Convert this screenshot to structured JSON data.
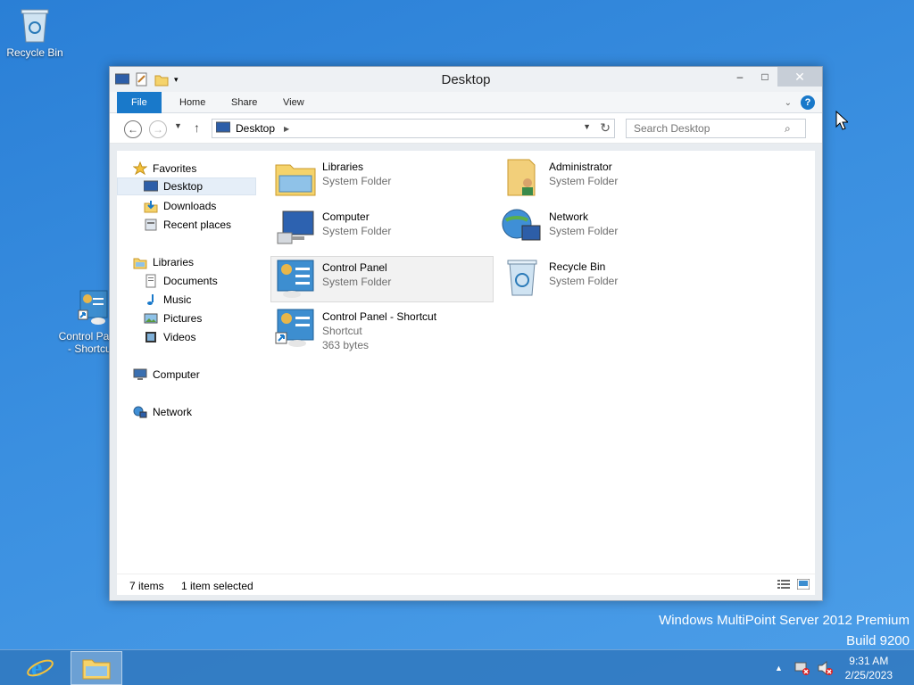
{
  "desktop": {
    "icons": [
      {
        "label": "Recycle Bin"
      },
      {
        "label": "Control Panel - Shortcut"
      }
    ]
  },
  "window": {
    "title": "Desktop",
    "caption": {
      "minimize": "–",
      "maximize": "□",
      "close": "✕"
    },
    "ribbon": {
      "tabs": [
        "File",
        "Home",
        "Share",
        "View"
      ]
    },
    "address": {
      "path": "Desktop"
    },
    "search": {
      "placeholder": "Search Desktop"
    },
    "navpane": {
      "favorites": "Favorites",
      "favorites_items": [
        "Desktop",
        "Downloads",
        "Recent places"
      ],
      "libraries": "Libraries",
      "libraries_items": [
        "Documents",
        "Music",
        "Pictures",
        "Videos"
      ],
      "computer": "Computer",
      "network": "Network"
    },
    "items": [
      {
        "name": "Libraries",
        "sub": "System Folder"
      },
      {
        "name": "Administrator",
        "sub": "System Folder"
      },
      {
        "name": "Computer",
        "sub": "System Folder"
      },
      {
        "name": "Network",
        "sub": "System Folder"
      },
      {
        "name": "Control Panel",
        "sub": "System Folder"
      },
      {
        "name": "Recycle Bin",
        "sub": "System Folder"
      },
      {
        "name": "Control Panel - Shortcut",
        "sub": "Shortcut",
        "size": "363 bytes"
      }
    ],
    "status": {
      "count": "7 items",
      "selected": "1 item selected"
    }
  },
  "watermark": {
    "line1": "Windows MultiPoint Server 2012 Premium",
    "line2": "Build 9200"
  },
  "taskbar": {
    "clock": {
      "time": "9:31 AM",
      "date": "2/25/2023"
    },
    "tray_chevron": "▲"
  },
  "colors": {
    "accent": "#1979ca",
    "desktop": "#3a8fe0",
    "selection": "#e5eef8"
  }
}
